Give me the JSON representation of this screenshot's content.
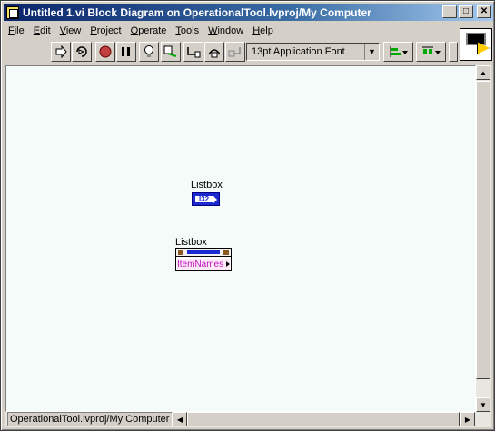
{
  "window": {
    "title": "Untitled 1.vi Block Diagram on OperationalTool.lvproj/My Computer",
    "buttons": {
      "minimize": "_",
      "maximize": "□",
      "close": "✕"
    }
  },
  "menu": [
    {
      "label": "File",
      "u": "F",
      "rest": "ile"
    },
    {
      "label": "Edit",
      "u": "E",
      "rest": "dit"
    },
    {
      "label": "View",
      "u": "V",
      "rest": "iew"
    },
    {
      "label": "Project",
      "u": "P",
      "rest": "roject"
    },
    {
      "label": "Operate",
      "u": "O",
      "rest": "perate"
    },
    {
      "label": "Tools",
      "u": "T",
      "rest": "ools"
    },
    {
      "label": "Window",
      "u": "W",
      "rest": "indow"
    },
    {
      "label": "Help",
      "u": "H",
      "rest": "elp"
    }
  ],
  "toolbar": {
    "font_selector": "13pt Application Font",
    "icons": [
      "run-arrow-icon",
      "run-continuously-icon",
      "abort-icon",
      "pause-icon",
      "highlight-execution-icon",
      "retain-wire-values-icon",
      "step-into-icon",
      "step-over-icon",
      "step-out-icon",
      "align-objects-icon",
      "distribute-objects-icon"
    ]
  },
  "diagram": {
    "terminal_label": "Listbox",
    "terminal_type": "I32",
    "property_node_label": "Listbox",
    "property_name": "ItemNames"
  },
  "status": {
    "path": "OperationalTool.lvproj/My Computer"
  }
}
